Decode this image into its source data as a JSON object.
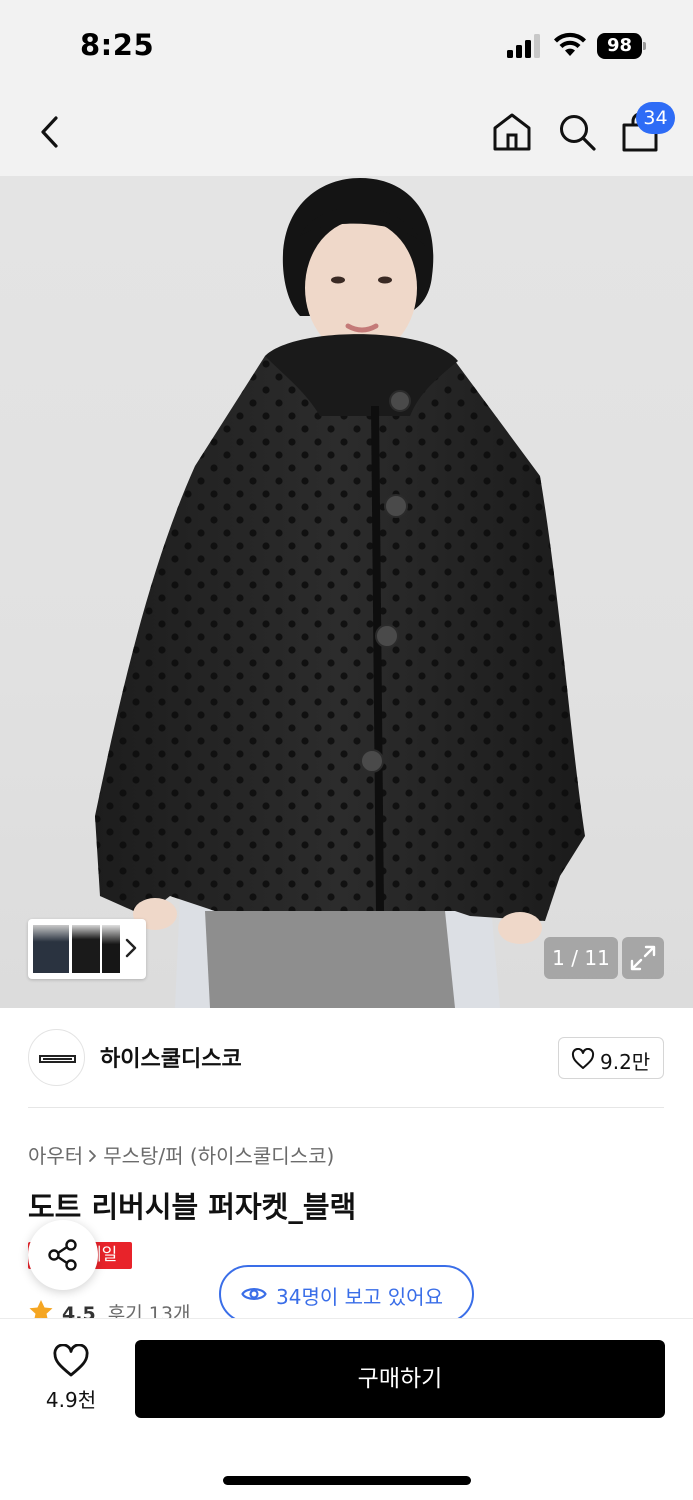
{
  "status_bar": {
    "time": "8:25",
    "battery": "98",
    "icons": [
      "signal-icon",
      "wifi-icon",
      "battery-icon"
    ]
  },
  "nav": {
    "icons": [
      "back-chevron-icon",
      "home-icon",
      "search-icon",
      "shopping-bag-icon"
    ],
    "cart_count": "34"
  },
  "gallery": {
    "counter": "1 / 11",
    "thumbnails": [
      "thumbnail-1",
      "thumbnail-2",
      "thumbnail-3"
    ],
    "icons": [
      "chevron-right-icon",
      "expand-icon"
    ]
  },
  "brand": {
    "name": "하이스쿨디스코",
    "likes": "9.2만",
    "logo_icon": "brand-logo"
  },
  "product": {
    "breadcrumb": [
      "아우터",
      "무스탕/퍼 (하이스쿨디스코)"
    ],
    "title": "도트 리버시블 퍼자켓_블랙",
    "sale_badge": "세일",
    "rating": "4.5",
    "reviews": "후기 13개"
  },
  "viewers": {
    "text": "34명이 보고 있어요"
  },
  "bottom_bar": {
    "wishlist_count": "4.9천",
    "buy_label": "구매하기"
  },
  "colors": {
    "accent_blue": "#2e6cf6",
    "sale_red": "#e8232a",
    "star_orange": "#f5a623",
    "buy_black": "#000000"
  }
}
